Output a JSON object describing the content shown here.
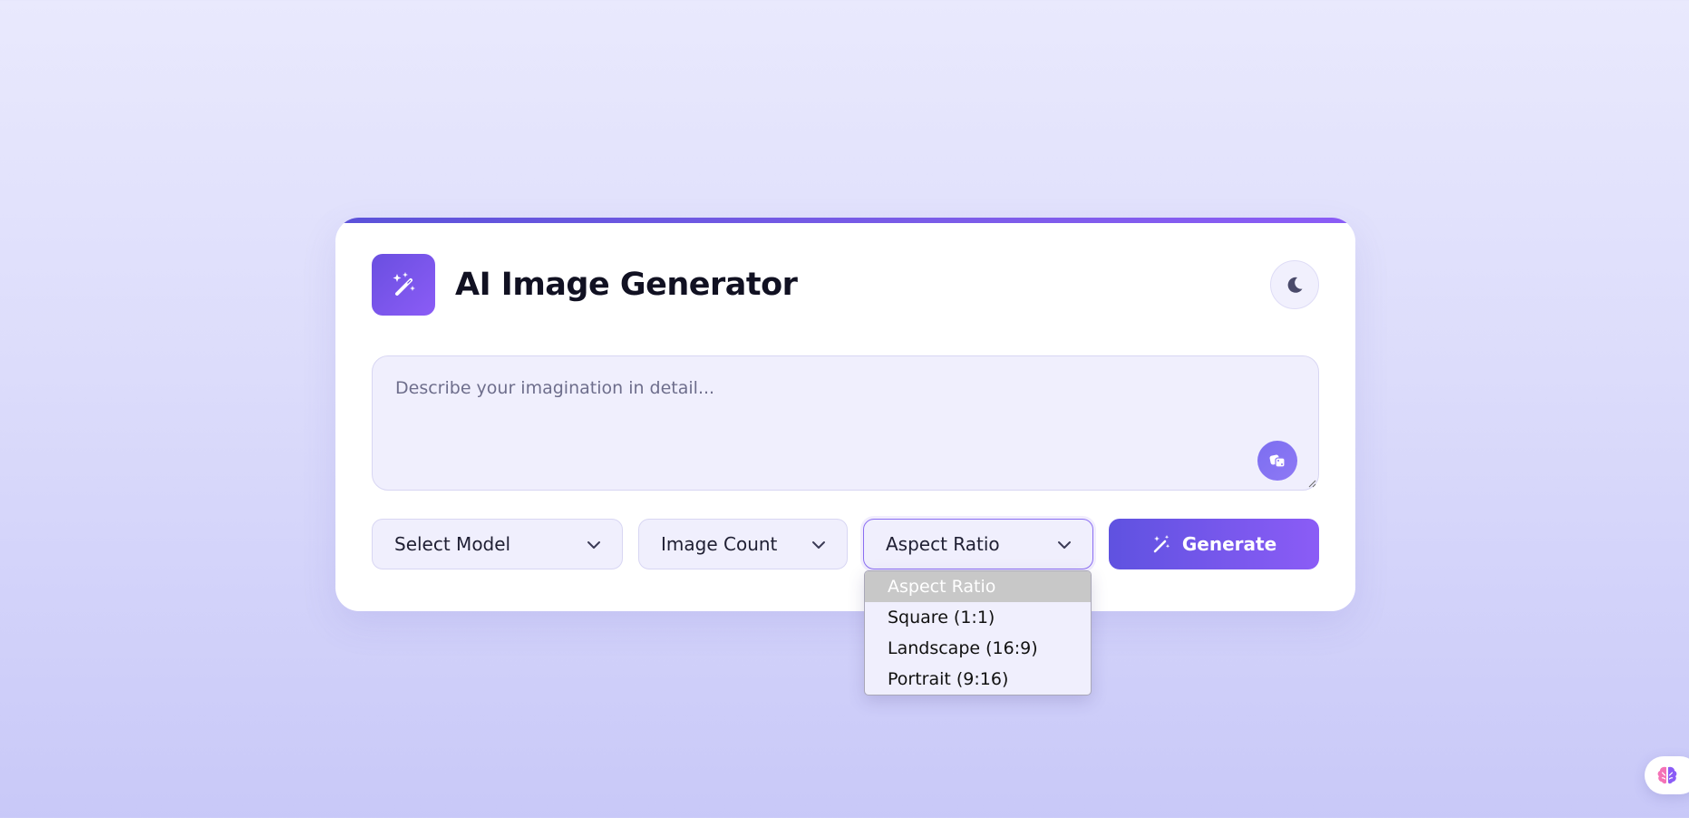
{
  "header": {
    "title": "AI Image Generator",
    "logo_icon": "magic-wand-sparkles",
    "theme_toggle_icon": "moon"
  },
  "prompt": {
    "placeholder": "Describe your imagination in detail...",
    "value": "",
    "random_button_icon": "dice"
  },
  "controls": {
    "model_select": {
      "value": "Select Model"
    },
    "count_select": {
      "value": "Image Count"
    },
    "ratio_select": {
      "value": "Aspect Ratio"
    },
    "generate_label": "Generate",
    "generate_icon": "magic-wand"
  },
  "ratio_dropdown": {
    "options": [
      "Aspect Ratio",
      "Square (1:1)",
      "Landscape (16:9)",
      "Portrait (9:16)"
    ],
    "highlighted_index": 0
  },
  "floating_button": {
    "icon": "brain"
  },
  "colors": {
    "accent_start": "#5f52e0",
    "accent_end": "#8b5cf6",
    "field_bg": "#f0effd"
  }
}
